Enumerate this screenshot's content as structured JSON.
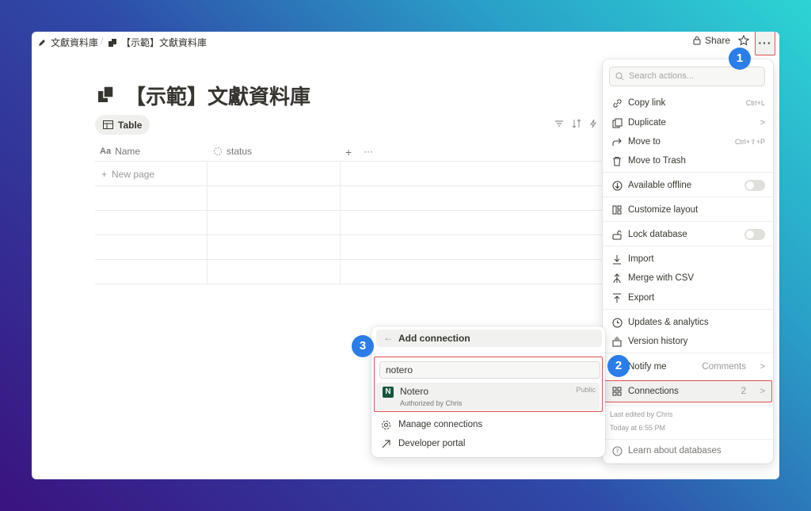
{
  "breadcrumb": {
    "item1": "文獻資料庫",
    "item2": "【示範】文獻資料庫",
    "separator": "/"
  },
  "topbar": {
    "share": "Share",
    "more": "···"
  },
  "page": {
    "title": "【示範】文獻資料庫",
    "view_tab": "Table"
  },
  "table": {
    "columns": [
      {
        "label": "Name",
        "icon": "Aa"
      },
      {
        "label": "status"
      }
    ],
    "add_column": "+",
    "column_more": "···",
    "new_page": "New page"
  },
  "menu": {
    "search_placeholder": "Search actions...",
    "items": [
      {
        "label": "Copy link",
        "shortcut": "Ctrl+L",
        "icon": "link-icon"
      },
      {
        "label": "Duplicate",
        "icon": "duplicate-icon"
      },
      {
        "label": "Move to",
        "shortcut": "Ctrl+⇧+P",
        "icon": "move-icon"
      },
      {
        "label": "Move to Trash",
        "icon": "trash-icon"
      },
      {
        "label": "Available offline",
        "icon": "offline-icon"
      },
      {
        "label": "Customize layout",
        "icon": "layout-icon"
      },
      {
        "label": "Lock database",
        "icon": "lock-icon"
      },
      {
        "label": "Import",
        "icon": "import-icon"
      },
      {
        "label": "Merge with CSV",
        "icon": "merge-icon"
      },
      {
        "label": "Export",
        "icon": "export-icon"
      },
      {
        "label": "Updates & analytics",
        "icon": "clock-icon"
      },
      {
        "label": "Version history",
        "icon": "history-icon"
      },
      {
        "label": "Notify me",
        "value": "Comments",
        "icon": "bell-icon"
      },
      {
        "label": "Connections",
        "value": "2",
        "icon": "connections-icon"
      },
      {
        "label": "Learn about databases",
        "icon": "help-icon"
      }
    ],
    "last_edited_by": "Last edited by Chris",
    "last_edited_at": "Today at 6:55 PM"
  },
  "popover": {
    "title": "Add connection",
    "search_value": "notero",
    "result": {
      "name": "Notero",
      "subtitle": "Authorized by Chris",
      "badge": "Public",
      "logo": "N"
    },
    "items": [
      {
        "label": "Manage connections"
      },
      {
        "label": "Developer portal"
      }
    ]
  },
  "badges": [
    "1",
    "2",
    "3"
  ],
  "colors": {
    "highlight": "#e25050",
    "badge": "#2b7de9",
    "notero": "#17563a"
  }
}
